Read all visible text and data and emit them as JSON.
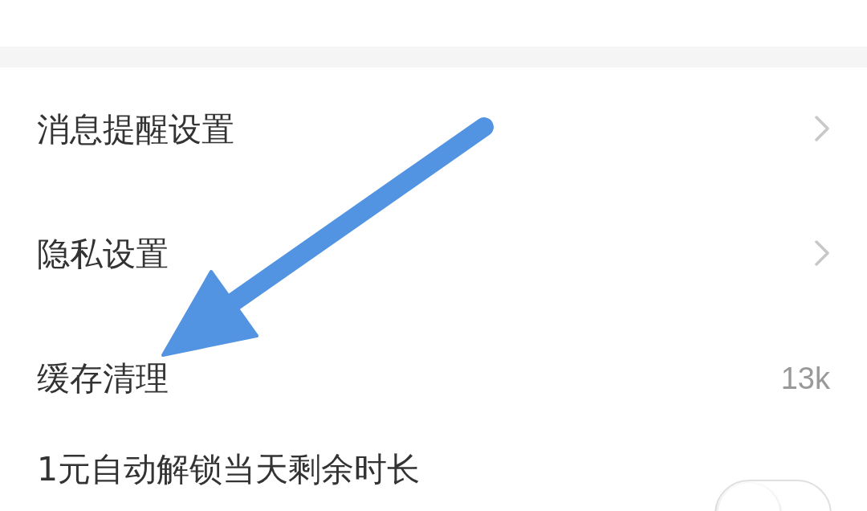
{
  "settings": [
    {
      "kind": "link",
      "label": "消息提醒设置"
    },
    {
      "kind": "link",
      "label": "隐私设置"
    },
    {
      "kind": "value",
      "label": "缓存清理",
      "value": "13k"
    },
    {
      "kind": "toggle",
      "label": "1元自动解锁当天剩余时长",
      "on": false
    }
  ]
}
